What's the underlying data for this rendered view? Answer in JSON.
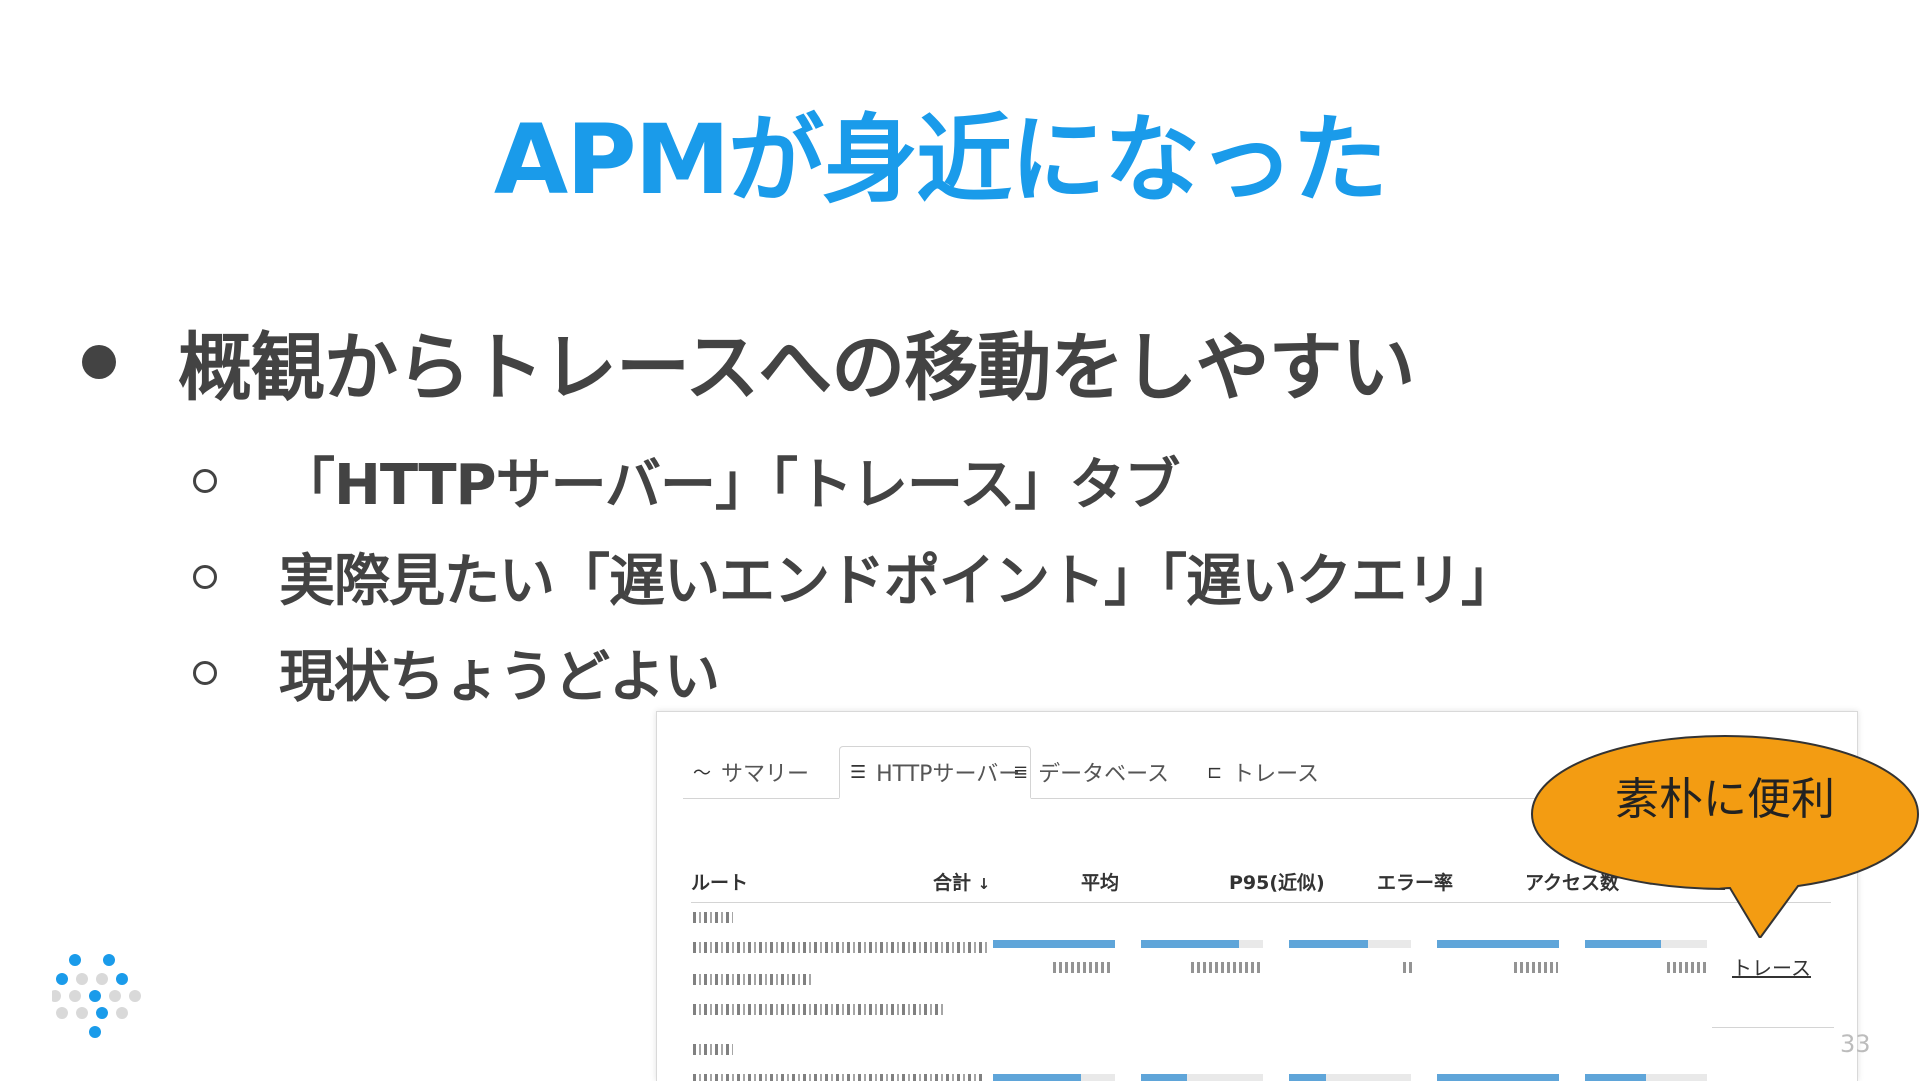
{
  "slide": {
    "title": "APMが身近になった",
    "page_number": "33"
  },
  "bullets": {
    "main": "概観からトレースへの移動をしやすい",
    "sub": [
      "「HTTPサーバー」「トレース」タブ",
      "実際見たい「遅いエンドポイント」「遅いクエリ」",
      "現状ちょうどよい"
    ]
  },
  "screenshot": {
    "tabs": [
      {
        "label": "サマリー",
        "icon": "chart-line-icon",
        "active": false
      },
      {
        "label": "HTTPサーバー",
        "icon": "server-icon",
        "active": true
      },
      {
        "label": "データベース",
        "icon": "database-icon",
        "active": false
      },
      {
        "label": "トレース",
        "icon": "trace-icon",
        "active": false
      }
    ],
    "columns": {
      "route": "ルート",
      "total": "合計",
      "total_sort": "↓",
      "avg": "平均",
      "p95": "P95(近似)",
      "error_rate": "エラー率",
      "access_count": "アクセス数"
    },
    "rows": [
      {
        "bars": [
          1.0,
          0.8,
          0.65,
          1.0,
          0.62
        ]
      },
      {
        "bars": [
          0.72,
          0.38,
          0.3,
          1.0,
          0.5
        ]
      }
    ],
    "trace_link": "トレース"
  },
  "callout": {
    "text": "素朴に便利",
    "color": "#f39c12"
  },
  "colors": {
    "title": "#1a9bea",
    "body_text": "#434343",
    "bar": "#5fa5d9"
  }
}
